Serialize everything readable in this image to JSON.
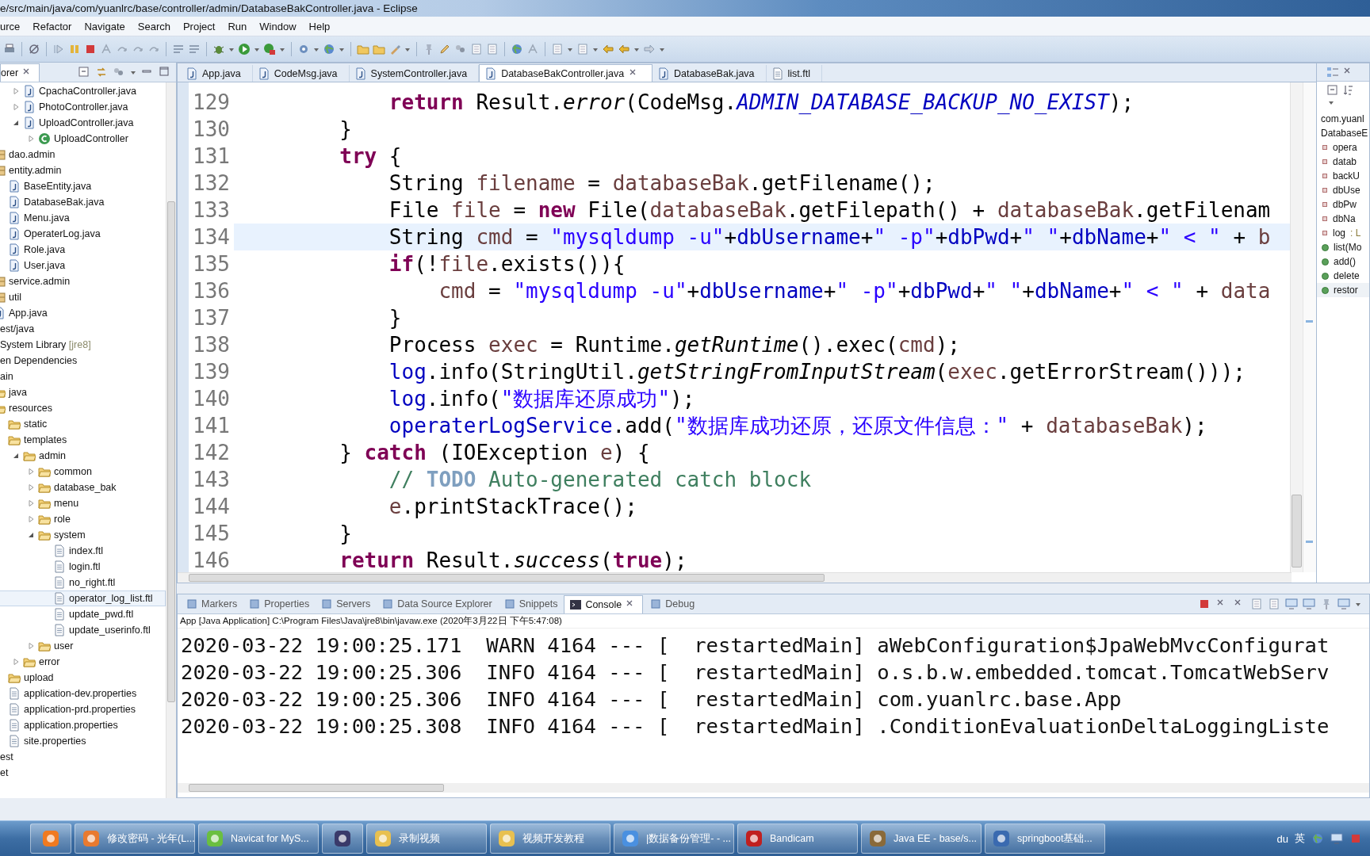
{
  "window": {
    "title": "e/src/main/java/com/yuanlrc/base/controller/admin/DatabaseBakController.java - Eclipse"
  },
  "menu": [
    "urce",
    "Refactor",
    "Navigate",
    "Search",
    "Project",
    "Run",
    "Window",
    "Help"
  ],
  "explorer": {
    "tab_label": "orer",
    "tree": [
      {
        "children": [
          {
            "children": [
              {
                "children": [
                  {
                    "label": "CpachaController.java",
                    "kind": "java",
                    "expanded": false,
                    "selected": false
                  },
                  {
                    "label": "PhotoController.java",
                    "kind": "java",
                    "expanded": false,
                    "selected": false
                  },
                  {
                    "label": "UploadController.java",
                    "kind": "java",
                    "expanded": true,
                    "selected": false,
                    "children": [
                      {
                        "label": "UploadController",
                        "kind": "class",
                        "expanded": false,
                        "selected": false
                      }
                    ]
                  }
                ]
              }
            ]
          },
          {
            "label": "dao.admin",
            "kind": "package",
            "selected": false
          },
          {
            "label": "entity.admin",
            "kind": "package",
            "selected": false,
            "children": [
              {
                "label": "BaseEntity.java",
                "kind": "java",
                "selected": false
              },
              {
                "label": "DatabaseBak.java",
                "kind": "java",
                "selected": false
              },
              {
                "label": "Menu.java",
                "kind": "java",
                "selected": false
              },
              {
                "label": "OperaterLog.java",
                "kind": "java",
                "selected": false
              },
              {
                "label": "Role.java",
                "kind": "java",
                "selected": false
              },
              {
                "label": "User.java",
                "kind": "java",
                "selected": false
              }
            ]
          },
          {
            "label": "service.admin",
            "kind": "package",
            "selected": false
          },
          {
            "label": "util",
            "kind": "package",
            "selected": false
          },
          {
            "label": "App.java",
            "kind": "java",
            "selected": false
          }
        ]
      },
      {
        "label": "est/java",
        "selected": false
      },
      {
        "label": "System Library",
        "decoration": "[jre8]",
        "selected": false
      },
      {
        "label": "en Dependencies",
        "selected": false
      },
      {
        "label": "ain",
        "selected": false,
        "children": [
          {
            "label": "java",
            "kind": "folder",
            "selected": false
          },
          {
            "label": "resources",
            "kind": "folder",
            "selected": false,
            "children": [
              {
                "label": "static",
                "kind": "folder",
                "selected": false
              },
              {
                "label": "templates",
                "kind": "folder",
                "selected": false,
                "children": [
                  {
                    "label": "admin",
                    "kind": "folder",
                    "expanded": true,
                    "selected": false,
                    "children": [
                      {
                        "label": "common",
                        "kind": "folder",
                        "expanded": false,
                        "selected": false
                      },
                      {
                        "label": "database_bak",
                        "kind": "folder",
                        "expanded": false,
                        "selected": false
                      },
                      {
                        "label": "menu",
                        "kind": "folder",
                        "expanded": false,
                        "selected": false
                      },
                      {
                        "label": "role",
                        "kind": "folder",
                        "expanded": false,
                        "selected": false
                      },
                      {
                        "label": "system",
                        "kind": "folder",
                        "expanded": true,
                        "selected": false,
                        "children": [
                          {
                            "label": "index.ftl",
                            "kind": "file",
                            "selected": false
                          },
                          {
                            "label": "login.ftl",
                            "kind": "file",
                            "selected": false
                          },
                          {
                            "label": "no_right.ftl",
                            "kind": "file",
                            "selected": false
                          },
                          {
                            "label": "operator_log_list.ftl",
                            "kind": "file",
                            "selected": true
                          },
                          {
                            "label": "update_pwd.ftl",
                            "kind": "file",
                            "selected": false
                          },
                          {
                            "label": "update_userinfo.ftl",
                            "kind": "file",
                            "selected": false
                          }
                        ]
                      },
                      {
                        "label": "user",
                        "kind": "folder",
                        "expanded": false,
                        "selected": false
                      }
                    ]
                  },
                  {
                    "label": "error",
                    "kind": "folder",
                    "expanded": false,
                    "selected": false
                  }
                ]
              },
              {
                "label": "upload",
                "kind": "folder",
                "selected": false
              },
              {
                "label": "application-dev.properties",
                "kind": "file",
                "selected": false
              },
              {
                "label": "application-prd.properties",
                "kind": "file",
                "selected": false
              },
              {
                "label": "application.properties",
                "kind": "file",
                "selected": false
              },
              {
                "label": "site.properties",
                "kind": "file",
                "selected": false
              }
            ]
          }
        ]
      },
      {
        "label": "est",
        "selected": false
      },
      {
        "label": "et",
        "selected": false
      }
    ]
  },
  "editor": {
    "tabs": [
      {
        "label": "App.java",
        "kind": "java",
        "selected": false
      },
      {
        "label": "CodeMsg.java",
        "kind": "java",
        "selected": false
      },
      {
        "label": "SystemController.java",
        "kind": "java",
        "selected": false
      },
      {
        "label": "DatabaseBakController.java",
        "kind": "java",
        "selected": true
      },
      {
        "label": "DatabaseBak.java",
        "kind": "java",
        "selected": false
      },
      {
        "label": "list.ftl",
        "kind": "file",
        "selected": false
      }
    ],
    "lines": [
      {
        "number": "129",
        "current": false,
        "tokens": [
          {
            "kind": "kw",
            "text": "            return"
          },
          {
            "kind": "pl",
            "text": " Result."
          },
          {
            "kind": "sm",
            "text": "error"
          },
          {
            "kind": "pl",
            "text": "(CodeMsg."
          },
          {
            "kind": "sf",
            "text": "ADMIN_DATABASE_BACKUP_NO_EXIST"
          },
          {
            "kind": "pl",
            "text": ");"
          }
        ]
      },
      {
        "number": "130",
        "current": false,
        "tokens": [
          {
            "kind": "pl",
            "text": "        }"
          }
        ]
      },
      {
        "number": "131",
        "current": false,
        "tokens": [
          {
            "kind": "kw",
            "text": "        try"
          },
          {
            "kind": "pl",
            "text": " {"
          }
        ]
      },
      {
        "number": "132",
        "current": false,
        "tokens": [
          {
            "kind": "pl",
            "text": "            String "
          },
          {
            "kind": "loc",
            "text": "filename"
          },
          {
            "kind": "pl",
            "text": " = "
          },
          {
            "kind": "loc",
            "text": "databaseBak"
          },
          {
            "kind": "pl",
            "text": ".getFilename();"
          }
        ]
      },
      {
        "number": "133",
        "current": false,
        "tokens": [
          {
            "kind": "pl",
            "text": "            File "
          },
          {
            "kind": "loc",
            "text": "file"
          },
          {
            "kind": "pl",
            "text": " = "
          },
          {
            "kind": "kw",
            "text": "new"
          },
          {
            "kind": "pl",
            "text": " File("
          },
          {
            "kind": "loc",
            "text": "databaseBak"
          },
          {
            "kind": "pl",
            "text": ".getFilepath() + "
          },
          {
            "kind": "loc",
            "text": "databaseBak"
          },
          {
            "kind": "pl",
            "text": ".getFilenam"
          }
        ]
      },
      {
        "number": "134",
        "current": true,
        "tokens": [
          {
            "kind": "pl",
            "text": "            String "
          },
          {
            "kind": "loc",
            "text": "cmd"
          },
          {
            "kind": "pl",
            "text": " = "
          },
          {
            "kind": "str",
            "text": "\"mysqldump -u\""
          },
          {
            "kind": "pl",
            "text": "+"
          },
          {
            "kind": "fld",
            "text": "dbUsername"
          },
          {
            "kind": "pl",
            "text": "+"
          },
          {
            "kind": "str",
            "text": "\" -p\""
          },
          {
            "kind": "pl",
            "text": "+"
          },
          {
            "kind": "fld",
            "text": "dbPwd"
          },
          {
            "kind": "pl",
            "text": "+"
          },
          {
            "kind": "str",
            "text": "\" \""
          },
          {
            "kind": "pl",
            "text": "+"
          },
          {
            "kind": "fld",
            "text": "dbName"
          },
          {
            "kind": "pl",
            "text": "+"
          },
          {
            "kind": "str",
            "text": "\" < \""
          },
          {
            "kind": "pl",
            "text": " + "
          },
          {
            "kind": "loc",
            "text": "b"
          }
        ]
      },
      {
        "number": "135",
        "current": false,
        "tokens": [
          {
            "kind": "kw",
            "text": "            if"
          },
          {
            "kind": "pl",
            "text": "(!"
          },
          {
            "kind": "loc",
            "text": "file"
          },
          {
            "kind": "pl",
            "text": ".exists()){"
          }
        ]
      },
      {
        "number": "136",
        "current": false,
        "tokens": [
          {
            "kind": "loc",
            "text": "                cmd"
          },
          {
            "kind": "pl",
            "text": " = "
          },
          {
            "kind": "str",
            "text": "\"mysqldump -u\""
          },
          {
            "kind": "pl",
            "text": "+"
          },
          {
            "kind": "fld",
            "text": "dbUsername"
          },
          {
            "kind": "pl",
            "text": "+"
          },
          {
            "kind": "str",
            "text": "\" -p\""
          },
          {
            "kind": "pl",
            "text": "+"
          },
          {
            "kind": "fld",
            "text": "dbPwd"
          },
          {
            "kind": "pl",
            "text": "+"
          },
          {
            "kind": "str",
            "text": "\" \""
          },
          {
            "kind": "pl",
            "text": "+"
          },
          {
            "kind": "fld",
            "text": "dbName"
          },
          {
            "kind": "pl",
            "text": "+"
          },
          {
            "kind": "str",
            "text": "\" < \""
          },
          {
            "kind": "pl",
            "text": " + "
          },
          {
            "kind": "loc",
            "text": "data"
          }
        ]
      },
      {
        "number": "137",
        "current": false,
        "tokens": [
          {
            "kind": "pl",
            "text": "            }"
          }
        ]
      },
      {
        "number": "138",
        "current": false,
        "tokens": [
          {
            "kind": "pl",
            "text": "            Process "
          },
          {
            "kind": "loc",
            "text": "exec"
          },
          {
            "kind": "pl",
            "text": " = Runtime."
          },
          {
            "kind": "sm",
            "text": "getRuntime"
          },
          {
            "kind": "pl",
            "text": "().exec("
          },
          {
            "kind": "loc",
            "text": "cmd"
          },
          {
            "kind": "pl",
            "text": ");"
          }
        ]
      },
      {
        "number": "139",
        "current": false,
        "tokens": [
          {
            "kind": "fld",
            "text": "            log"
          },
          {
            "kind": "pl",
            "text": ".info(StringUtil."
          },
          {
            "kind": "sm",
            "text": "getStringFromInputStream"
          },
          {
            "kind": "pl",
            "text": "("
          },
          {
            "kind": "loc",
            "text": "exec"
          },
          {
            "kind": "pl",
            "text": ".getErrorStream()));"
          }
        ]
      },
      {
        "number": "140",
        "current": false,
        "tokens": [
          {
            "kind": "fld",
            "text": "            log"
          },
          {
            "kind": "pl",
            "text": ".info("
          },
          {
            "kind": "str",
            "text": "\"数据库还原成功\""
          },
          {
            "kind": "pl",
            "text": ");"
          }
        ]
      },
      {
        "number": "141",
        "current": false,
        "tokens": [
          {
            "kind": "fld",
            "text": "            operaterLogService"
          },
          {
            "kind": "pl",
            "text": ".add("
          },
          {
            "kind": "str",
            "text": "\"数据库成功还原，还原文件信息：\""
          },
          {
            "kind": "pl",
            "text": " + "
          },
          {
            "kind": "loc",
            "text": "databaseBak"
          },
          {
            "kind": "pl",
            "text": ");"
          }
        ]
      },
      {
        "number": "142",
        "current": false,
        "tokens": [
          {
            "kind": "pl",
            "text": "        } "
          },
          {
            "kind": "kw",
            "text": "catch"
          },
          {
            "kind": "pl",
            "text": " (IOException "
          },
          {
            "kind": "loc",
            "text": "e"
          },
          {
            "kind": "pl",
            "text": ") {"
          }
        ]
      },
      {
        "number": "143",
        "current": false,
        "tokens": [
          {
            "kind": "com",
            "text": "            // "
          },
          {
            "kind": "todo",
            "text": "TODO"
          },
          {
            "kind": "com",
            "text": " Auto-generated catch block"
          }
        ]
      },
      {
        "number": "144",
        "current": false,
        "tokens": [
          {
            "kind": "loc",
            "text": "            e"
          },
          {
            "kind": "pl",
            "text": ".printStackTrace();"
          }
        ]
      },
      {
        "number": "145",
        "current": false,
        "tokens": [
          {
            "kind": "pl",
            "text": "        }"
          }
        ]
      },
      {
        "number": "146",
        "current": false,
        "tokens": [
          {
            "kind": "kw",
            "text": "        return"
          },
          {
            "kind": "pl",
            "text": " Result."
          },
          {
            "kind": "sm",
            "text": "success"
          },
          {
            "kind": "pl",
            "text": "("
          },
          {
            "kind": "kw",
            "text": "true"
          },
          {
            "kind": "pl",
            "text": ");"
          }
        ]
      }
    ]
  },
  "outline": {
    "items": [
      {
        "label": "com.yuanl",
        "kind": "header",
        "selected": false
      },
      {
        "label": "DatabaseE",
        "kind": "header",
        "selected": false
      },
      {
        "label": "opera",
        "kind": "field",
        "selected": false
      },
      {
        "label": "datab",
        "kind": "field",
        "selected": false
      },
      {
        "label": "backU",
        "kind": "field",
        "selected": false
      },
      {
        "label": "dbUse",
        "kind": "field",
        "selected": false
      },
      {
        "label": "dbPw",
        "kind": "field",
        "selected": false
      },
      {
        "label": "dbNa",
        "kind": "field",
        "selected": false
      },
      {
        "label": "log",
        "type": " : L",
        "kind": "field",
        "selected": false
      },
      {
        "label": "list(Mo",
        "kind": "method",
        "selected": false
      },
      {
        "label": "add()",
        "kind": "method",
        "selected": false
      },
      {
        "label": "delete",
        "kind": "method",
        "selected": false
      },
      {
        "label": "restor",
        "kind": "method",
        "selected": true
      }
    ]
  },
  "console": {
    "tabs": [
      {
        "label": "Markers",
        "selected": false
      },
      {
        "label": "Properties",
        "selected": false
      },
      {
        "label": "Servers",
        "selected": false
      },
      {
        "label": "Data Source Explorer",
        "selected": false
      },
      {
        "label": "Snippets",
        "selected": false
      },
      {
        "label": "Console",
        "selected": true
      },
      {
        "label": "Debug",
        "selected": false
      }
    ],
    "process": "App [Java Application] C:\\Program Files\\Java\\jre8\\bin\\javaw.exe (2020年3月22日 下午5:47:08)",
    "lines": [
      "2020-03-22 19:00:25.171  WARN 4164 --- [  restartedMain] aWebConfiguration$JpaWebMvcConfigurat",
      "2020-03-22 19:00:25.306  INFO 4164 --- [  restartedMain] o.s.b.w.embedded.tomcat.TomcatWebServ",
      "2020-03-22 19:00:25.306  INFO 4164 --- [  restartedMain] com.yuanlrc.base.App",
      "2020-03-22 19:00:25.308  INFO 4164 --- [  restartedMain] .ConditionEvaluationDeltaLoggingListe"
    ]
  },
  "taskbar": {
    "apps": [
      {
        "kind": "launcher"
      },
      {
        "kind": "window",
        "label": "修改密码 - 光年(L..."
      },
      {
        "kind": "window",
        "label": "Navicat for MyS..."
      },
      {
        "kind": "launcher"
      },
      {
        "kind": "window",
        "label": "录制视频"
      },
      {
        "kind": "window",
        "label": "视频开发教程"
      },
      {
        "kind": "window",
        "label": "|数据备份管理- - ..."
      },
      {
        "kind": "window",
        "label": "Bandicam"
      },
      {
        "kind": "window",
        "label": "Java EE - base/s..."
      },
      {
        "kind": "window",
        "label": "springboot基础..."
      }
    ],
    "tray": [
      "du",
      "英"
    ]
  }
}
